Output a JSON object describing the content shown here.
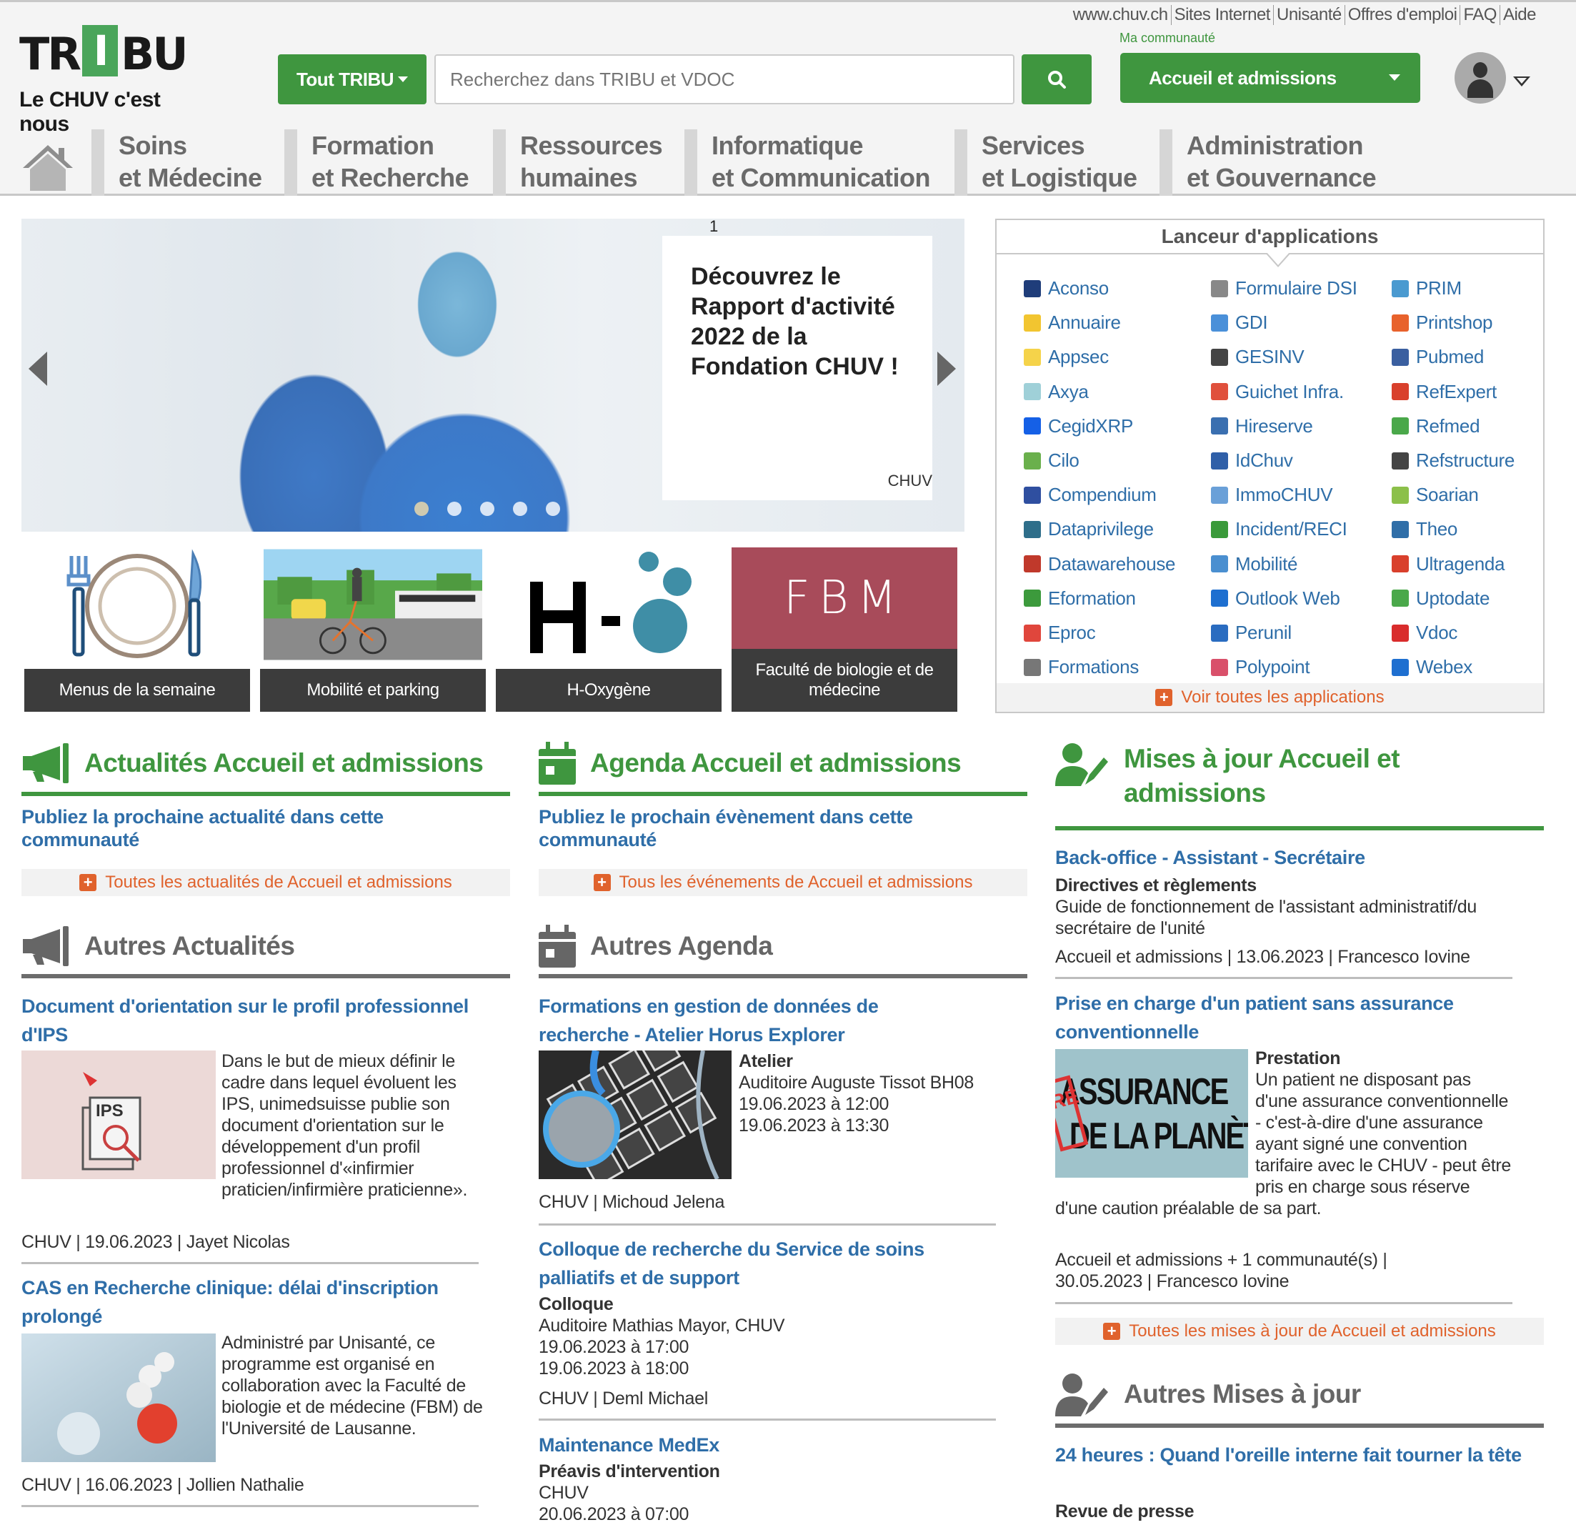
{
  "header": {
    "top_links": [
      "www.chuv.ch",
      "Sites Internet",
      "Unisanté",
      "Offres d'emploi",
      "FAQ",
      "Aide"
    ],
    "logo": {
      "word_left": "TR",
      "word_mid": "I",
      "word_right": "BU",
      "tagline": "Le CHUV c'est nous"
    },
    "scope_button": "Tout TRIBU",
    "search_placeholder": "Recherchez dans TRIBU et VDOC",
    "search_value": "",
    "community_label": "Ma communauté",
    "community_selected": "Accueil et admissions",
    "brand_color": "#3f963f"
  },
  "nav": [
    {
      "line1": "Soins",
      "line2": "et Médecine"
    },
    {
      "line1": "Formation",
      "line2": "et Recherche"
    },
    {
      "line1": "Ressources",
      "line2": "humaines"
    },
    {
      "line1": "Informatique",
      "line2": "et Communication"
    },
    {
      "line1": "Services",
      "line2": "et Logistique"
    },
    {
      "line1": "Administration",
      "line2": "et Gouvernance"
    }
  ],
  "hero": {
    "slide_number": "1",
    "title": "Découvrez le Rapport d'activité 2022 de la Fondation CHUV !",
    "source": "CHUV",
    "slide_count": 5,
    "active_slide": 1
  },
  "tiles": [
    {
      "label": "Menus de la semaine"
    },
    {
      "label": "Mobilité et parking"
    },
    {
      "label": "H-Oxygène"
    },
    {
      "label": "Faculté de biologie et de médecine",
      "image_text": "FBM"
    }
  ],
  "apps": {
    "title": "Lanceur d'applications",
    "columns": [
      [
        {
          "name": "Aconso",
          "icon": "aconso-icon",
          "color": "#1f3d7a"
        },
        {
          "name": "Annuaire",
          "icon": "phone-icon",
          "color": "#f2c530"
        },
        {
          "name": "Appsec",
          "icon": "lock-icon",
          "color": "#f5d34a"
        },
        {
          "name": "Axya",
          "icon": "triangle-icon",
          "color": "#9fd0d8"
        },
        {
          "name": "CegidXRP",
          "icon": "cegid-icon",
          "color": "#1560e6"
        },
        {
          "name": "Cilo",
          "icon": "map-pin-icon",
          "color": "#6ab04c"
        },
        {
          "name": "Compendium",
          "icon": "list-icon",
          "color": "#2f4fa0"
        },
        {
          "name": "Dataprivilege",
          "icon": "dataprivilege-icon",
          "color": "#2e6e8a"
        },
        {
          "name": "Datawarehouse",
          "icon": "cube-icon",
          "color": "#c0392b"
        },
        {
          "name": "Eformation",
          "icon": "graduation-icon",
          "color": "#3c9a3c"
        },
        {
          "name": "Eproc",
          "icon": "cart-icon",
          "color": "#e0463c"
        },
        {
          "name": "Formations",
          "icon": "group-icon",
          "color": "#777777"
        }
      ],
      [
        {
          "name": "Formulaire DSI",
          "icon": "monitor-icon",
          "color": "#888888"
        },
        {
          "name": "GDI",
          "icon": "user-icon",
          "color": "#4a90d9"
        },
        {
          "name": "GESINV",
          "icon": "database-icon",
          "color": "#444444"
        },
        {
          "name": "Guichet Infra.",
          "icon": "wrench-icon",
          "color": "#e0503c"
        },
        {
          "name": "Hireserve",
          "icon": "hireserve-icon",
          "color": "#3a6fb0"
        },
        {
          "name": "IdChuv",
          "icon": "arrow-down-icon",
          "color": "#2f5fa8"
        },
        {
          "name": "ImmoCHUV",
          "icon": "house-icon",
          "color": "#6aa0d8"
        },
        {
          "name": "Incident/RECI",
          "icon": "chat-icon",
          "color": "#3a9a3a"
        },
        {
          "name": "Mobilité",
          "icon": "parking-icon",
          "color": "#4a8fd0"
        },
        {
          "name": "Outlook Web",
          "icon": "outlook-icon",
          "color": "#1e6fd0"
        },
        {
          "name": "Perunil",
          "icon": "perunil-icon",
          "color": "#2a6cc0"
        },
        {
          "name": "Polypoint",
          "icon": "clock-icon",
          "color": "#d9506a"
        }
      ],
      [
        {
          "name": "PRIM",
          "icon": "prim-icon",
          "color": "#4a9ad0"
        },
        {
          "name": "Printshop",
          "icon": "printer-icon",
          "color": "#e8622c"
        },
        {
          "name": "Pubmed",
          "icon": "pubmed-icon",
          "color": "#3a5fa0"
        },
        {
          "name": "RefExpert",
          "icon": "refexpert-icon",
          "color": "#d9402c"
        },
        {
          "name": "Refmed",
          "icon": "cross-icon",
          "color": "#4aa84a"
        },
        {
          "name": "Refstructure",
          "icon": "network-icon",
          "color": "#444444"
        },
        {
          "name": "Soarian",
          "icon": "soarian-icon",
          "color": "#8cc04a"
        },
        {
          "name": "Theo",
          "icon": "theo-icon",
          "color": "#2f6ea8"
        },
        {
          "name": "Ultragenda",
          "icon": "calendar-clock-icon",
          "color": "#d9402c"
        },
        {
          "name": "Uptodate",
          "icon": "uptodate-icon",
          "color": "#4aa84a"
        },
        {
          "name": "Vdoc",
          "icon": "vdoc-icon",
          "color": "#d92c2c"
        },
        {
          "name": "Webex",
          "icon": "webex-icon",
          "color": "#1e6fd0"
        }
      ]
    ],
    "more": "Voir toutes les applications"
  },
  "news": {
    "title": "Actualités Accueil et admissions",
    "publish_link": "Publiez la prochaine actualité dans cette communauté",
    "more": "Toutes les actualités de Accueil et admissions"
  },
  "other_news": {
    "title": "Autres Actualités",
    "items": [
      {
        "title": "Document d'orientation sur le profil professionnel d'IPS",
        "summary": "Dans le but de mieux définir le cadre dans lequel évoluent les IPS, unimedsuisse publie son document d'orientation sur le développement d'un profil professionnel d'«infirmier praticien/infirmière praticienne».",
        "source": "CHUV",
        "date": "19.06.2023",
        "author": "Jayet Nicolas"
      },
      {
        "title": "CAS en Recherche clinique: délai d'inscription prolongé",
        "summary": "Administré par Unisanté, ce programme est organisé en collaboration avec la Faculté de biologie et de médecine (FBM) de l'Université de Lausanne.",
        "source": "CHUV",
        "date": "16.06.2023",
        "author": "Jollien Nathalie"
      }
    ]
  },
  "agenda": {
    "title": "Agenda Accueil et admissions",
    "publish_link": "Publiez le prochain évènement dans cette communauté",
    "more": "Tous les événements de Accueil et admissions"
  },
  "other_agenda": {
    "title": "Autres Agenda",
    "items": [
      {
        "title": "Formations en gestion de données de recherche - Atelier Horus Explorer",
        "type": "Atelier",
        "location": "Auditoire Auguste Tissot BH08",
        "start": "19.06.2023 à 12:00",
        "end": "19.06.2023 à 13:30",
        "source": "CHUV",
        "author": "Michoud Jelena"
      },
      {
        "title": "Colloque de recherche du Service de soins palliatifs et de support",
        "type": "Colloque",
        "location": "Auditoire Mathias Mayor, CHUV",
        "start": "19.06.2023 à 17:00",
        "end": "19.06.2023 à 18:00",
        "source": "CHUV",
        "author": "Deml Michael"
      },
      {
        "title": "Maintenance MedEx",
        "type": "Préavis d'intervention",
        "location": "CHUV",
        "start": "20.06.2023 à 07:00"
      }
    ]
  },
  "updates": {
    "title": "Mises à jour Accueil et admissions",
    "items": [
      {
        "title": "Back-office - Assistant - Secrétaire",
        "type": "Directives et règlements",
        "summary": "Guide de fonctionnement de l'assistant administratif/du secrétaire de l'unité",
        "community": "Accueil et admissions",
        "date": "13.06.2023",
        "author": "Francesco Iovine"
      },
      {
        "title": "Prise en charge d'un patient sans assurance conventionnelle",
        "type": "Prestation",
        "summary": "Un patient ne disposant pas d'une assurance conventionnelle - c'est-à-dire d'une assurance ayant signé une convention tarifaire avec le CHUV - peut être pris en charge sous réserve d'une caution préalable de sa part.",
        "community": "Accueil et admissions + 1 communauté(s)",
        "date": "30.05.2023",
        "author": "Francesco Iovine",
        "image_text_1": "ASSURANCE",
        "image_text_2": "DE LA PLANÈTE",
        "image_stamp": "RÉ"
      }
    ],
    "more": "Toutes les mises à jour de Accueil et admissions"
  },
  "other_updates": {
    "title": "Autres Mises à jour",
    "items": [
      {
        "title": "24 heures : Quand l'oreille interne fait tourner la tête",
        "type": "Revue de presse"
      }
    ]
  },
  "separator": " | "
}
